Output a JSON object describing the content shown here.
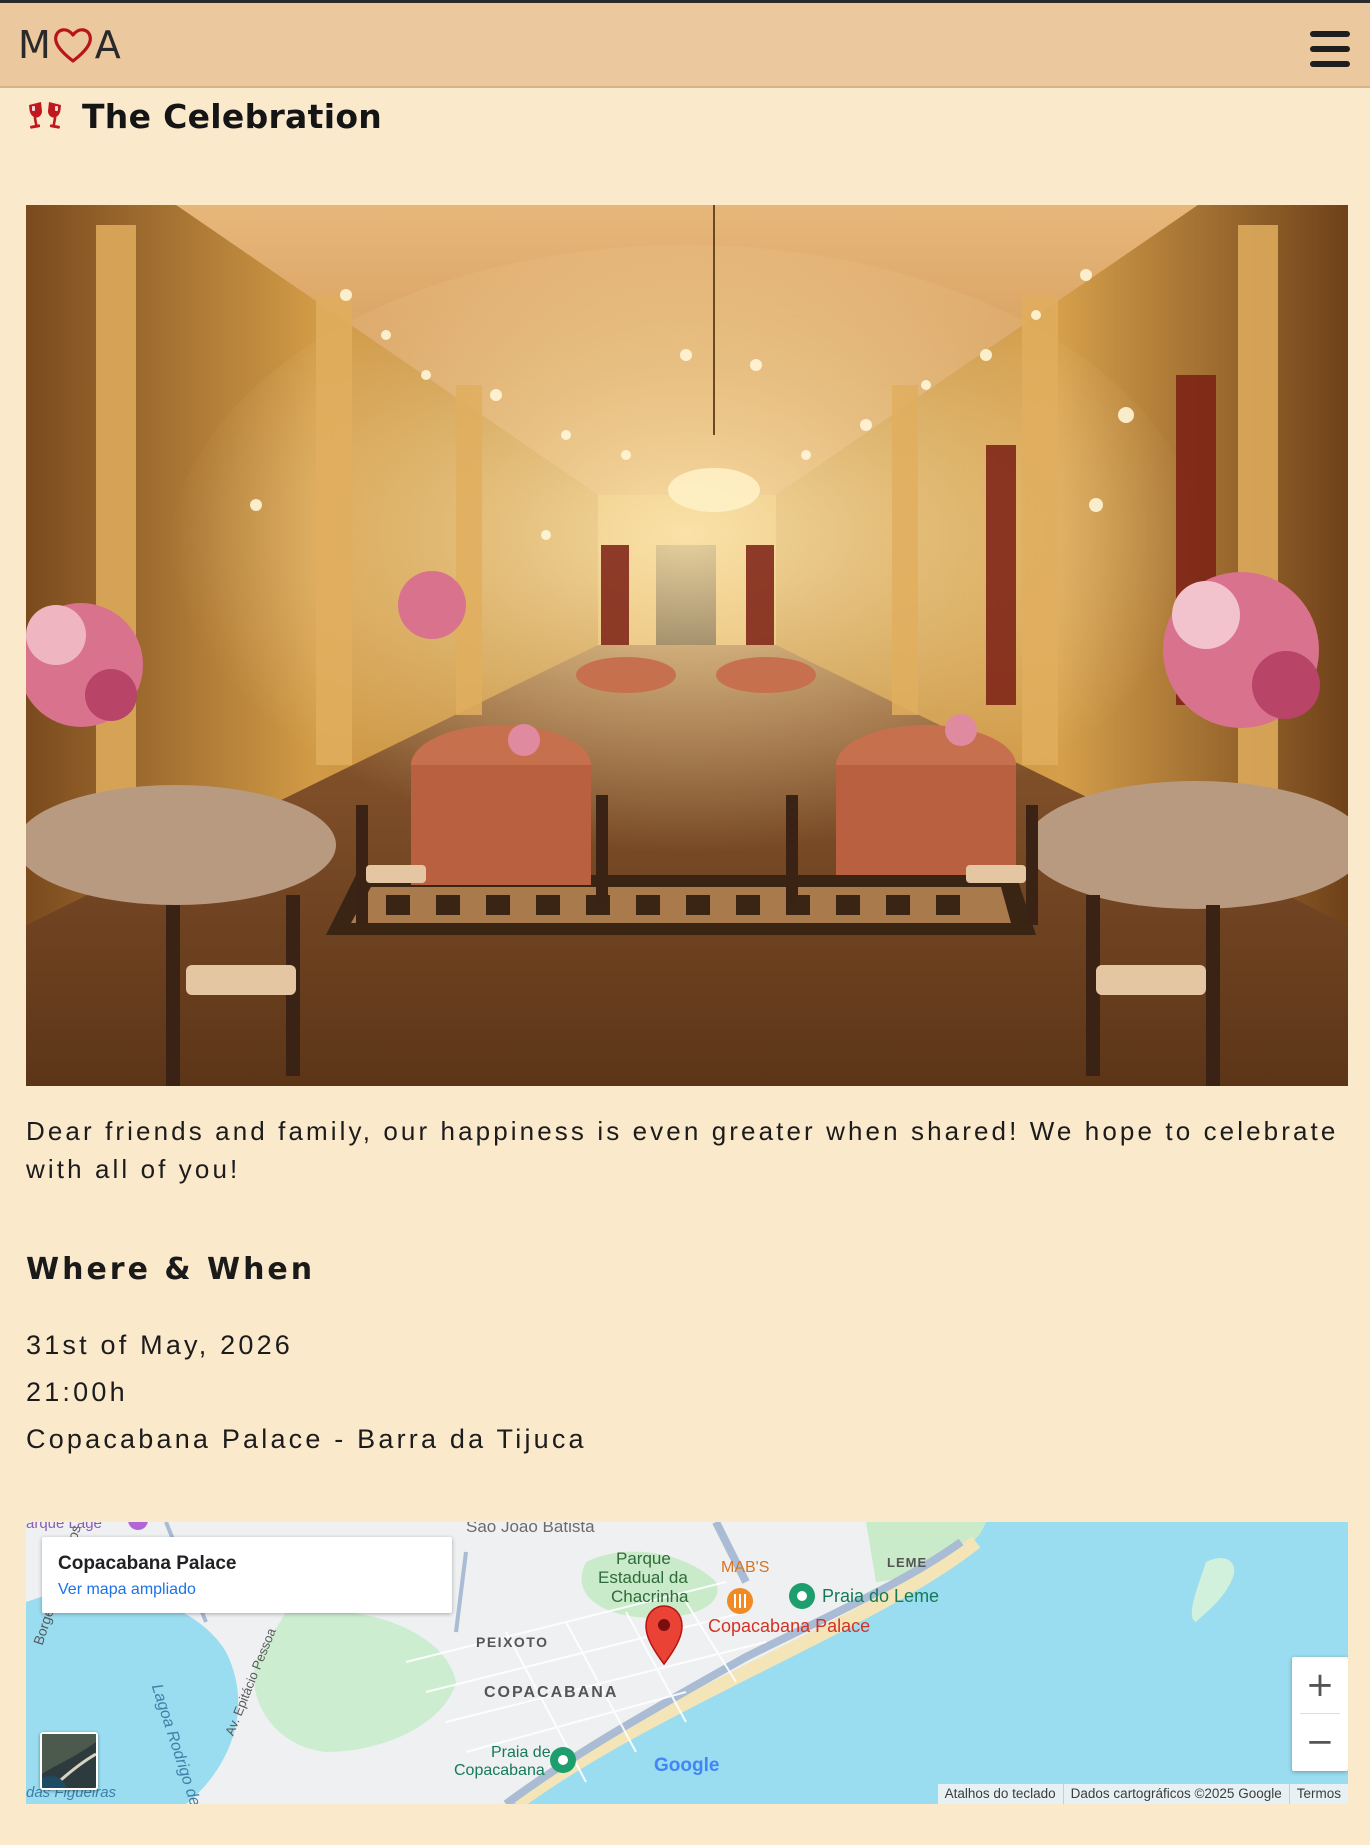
{
  "header": {
    "logo_left": "M",
    "logo_right": "A",
    "menu_icon": "hamburger-menu-icon"
  },
  "section": {
    "title": "The Celebration",
    "icon": "toast-glasses-icon"
  },
  "hero": {
    "image": "banquet-hall-photo"
  },
  "intro": "Dear friends and family, our happiness is even greater when shared! We hope to celebrate with all of you!",
  "where_when": {
    "title": "Where & When",
    "date": "31st of May, 2026",
    "time": "21:00h",
    "place": "Copacabana Palace - Barra da Tijuca"
  },
  "map": {
    "card_title": "Copacabana Palace",
    "card_link": "Ver mapa ampliado",
    "labels": {
      "sao_joao": "São João Batista",
      "parque_1": "Parque",
      "parque_2": "Estadual da",
      "parque_3": "Chacrinha",
      "mabs": "MAB'S",
      "leme": "LEME",
      "praia_leme": "Praia do Leme",
      "copa_palace": "Copacabana Palace",
      "peixoto": "PEIXOTO",
      "copacabana": "COPACABANA",
      "praia_copa_1": "Praia de",
      "praia_copa_2": "Copacabana",
      "borges": "Borges de Medeiros",
      "epitacio": "Av. Epitácio Pessoa",
      "lagoa": "Lagoa Rodrigo de",
      "figueiras": "das Figueiras",
      "parque_lage": "arque Lage",
      "google": "Google"
    },
    "zoom_in": "+",
    "zoom_out": "−",
    "attribution": {
      "shortcuts": "Atalhos do teclado",
      "data": "Dados cartográficos ©2025 Google",
      "terms": "Termos"
    }
  },
  "colors": {
    "page_bg": "#FBE9CC",
    "header_bg": "#EBC89D",
    "accent_red": "#C0181E",
    "map_water": "#9ADCF0",
    "map_link": "#1a73e8"
  }
}
